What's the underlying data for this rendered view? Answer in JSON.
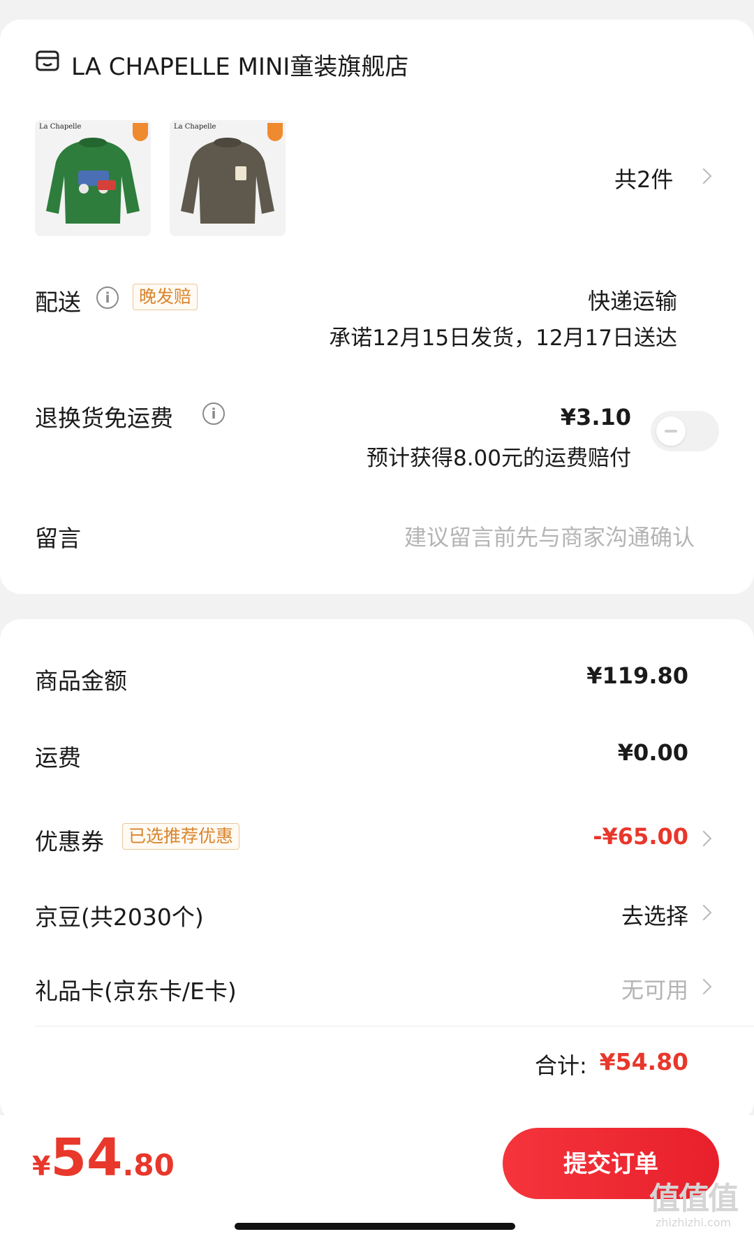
{
  "store": {
    "name": "LA CHAPELLE MINI童装旗舰店",
    "icon": "store-icon"
  },
  "products": {
    "brand_text": "La Chapelle",
    "items": [
      {
        "name": "green-sweatshirt",
        "color": "#2e7d3c"
      },
      {
        "name": "olive-sweatshirt",
        "color": "#5e594c"
      }
    ],
    "count_label": "共2件"
  },
  "delivery": {
    "label": "配送",
    "tag": "晚发赔",
    "method": "快递运输",
    "promise": "承诺12月15日发货，12月17日送达"
  },
  "return_shipping": {
    "label": "退换货免运费",
    "price": "¥3.10",
    "note": "预计获得8.00元的运费赔付",
    "enabled": false
  },
  "message": {
    "label": "留言",
    "placeholder": "建议留言前先与商家沟通确认"
  },
  "summary": {
    "goods_label": "商品金额",
    "goods_value": "¥119.80",
    "shipping_label": "运费",
    "shipping_value": "¥0.00",
    "coupon_label": "优惠券",
    "coupon_tag": "已选推荐优惠",
    "coupon_value": "-¥65.00",
    "beans_label": "京豆(共2030个)",
    "beans_action": "去选择",
    "giftcard_label": "礼品卡(京东卡/E卡)",
    "giftcard_value": "无可用",
    "total_label": "合计:",
    "total_value": "¥54.80"
  },
  "footer": {
    "currency": "¥",
    "price_int": "54",
    "price_dec": ".80",
    "submit_label": "提交订单"
  },
  "watermark": {
    "big": "值值值",
    "small": "zhizhizhi.com"
  },
  "colors": {
    "accent": "#e8372b",
    "tag_border": "#e9c79c",
    "tag_text": "#d9852d"
  }
}
